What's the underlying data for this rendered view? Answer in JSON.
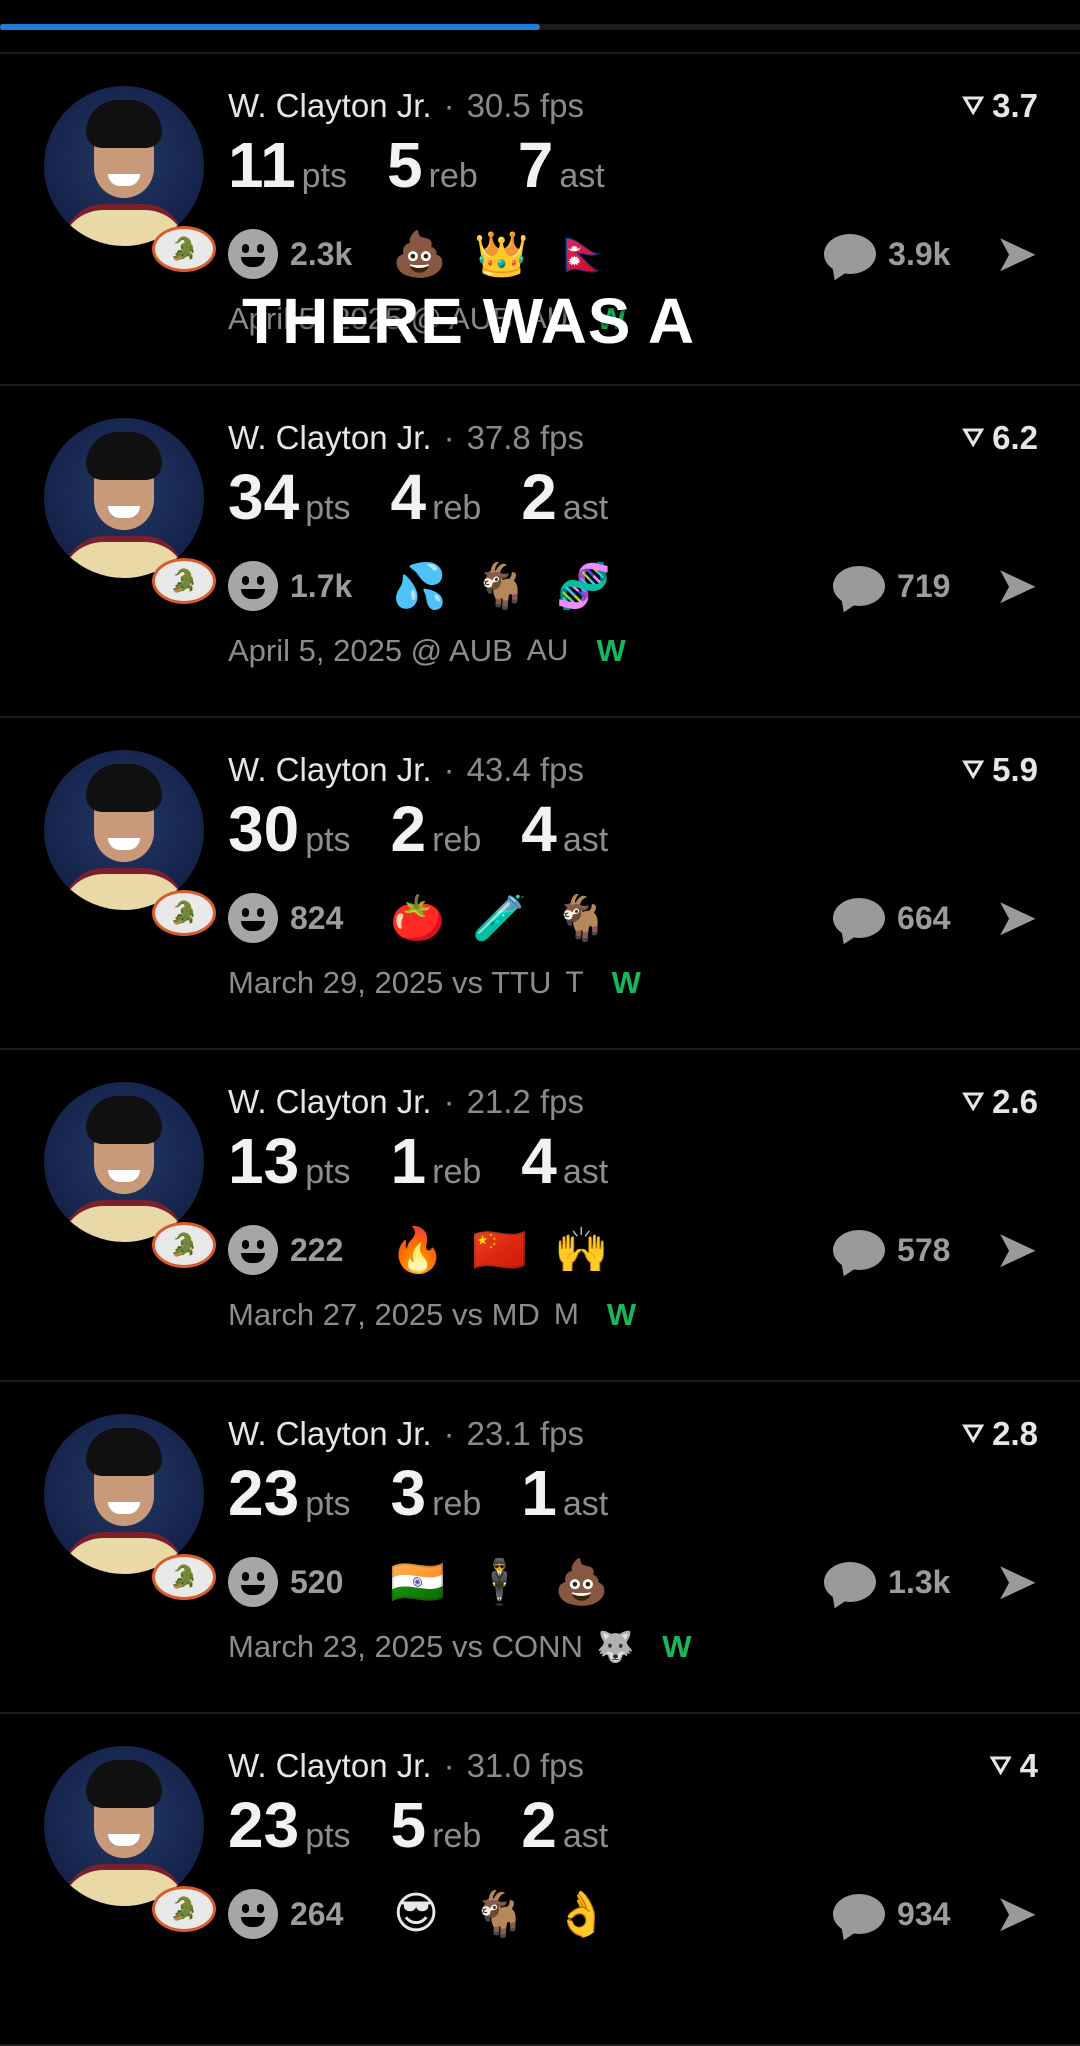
{
  "progress": {
    "fraction": 0.5
  },
  "caption": "THERE WAS A",
  "cards": [
    {
      "name": "W. Clayton Jr.",
      "fps": "30.5 fps",
      "rating": "3.7",
      "stats": [
        {
          "num": "11",
          "unit": "pts"
        },
        {
          "num": "5",
          "unit": "reb"
        },
        {
          "num": "7",
          "unit": "ast"
        }
      ],
      "reactions_count": "2.3k",
      "emojis": [
        "💩",
        "👑",
        "🇳🇵"
      ],
      "comments": "3.9k",
      "date": "April 5, 2025 @ AUB",
      "opp_logo": "AU",
      "result": "W"
    },
    {
      "name": "W. Clayton Jr.",
      "fps": "37.8 fps",
      "rating": "6.2",
      "stats": [
        {
          "num": "34",
          "unit": "pts"
        },
        {
          "num": "4",
          "unit": "reb"
        },
        {
          "num": "2",
          "unit": "ast"
        }
      ],
      "reactions_count": "1.7k",
      "emojis": [
        "💦",
        "🐐",
        "🧬"
      ],
      "comments": "719",
      "date": "April 5, 2025 @ AUB",
      "opp_logo": "AU",
      "result": "W"
    },
    {
      "name": "W. Clayton Jr.",
      "fps": "43.4 fps",
      "rating": "5.9",
      "stats": [
        {
          "num": "30",
          "unit": "pts"
        },
        {
          "num": "2",
          "unit": "reb"
        },
        {
          "num": "4",
          "unit": "ast"
        }
      ],
      "reactions_count": "824",
      "emojis": [
        "🍅",
        "🧪",
        "🐐"
      ],
      "comments": "664",
      "date": "March 29, 2025 vs TTU",
      "opp_logo": "T",
      "result": "W"
    },
    {
      "name": "W. Clayton Jr.",
      "fps": "21.2 fps",
      "rating": "2.6",
      "stats": [
        {
          "num": "13",
          "unit": "pts"
        },
        {
          "num": "1",
          "unit": "reb"
        },
        {
          "num": "4",
          "unit": "ast"
        }
      ],
      "reactions_count": "222",
      "emojis": [
        "🔥",
        "🇨🇳",
        "🙌"
      ],
      "comments": "578",
      "date": "March 27, 2025 vs MD",
      "opp_logo": "M",
      "result": "W"
    },
    {
      "name": "W. Clayton Jr.",
      "fps": "23.1 fps",
      "rating": "2.8",
      "stats": [
        {
          "num": "23",
          "unit": "pts"
        },
        {
          "num": "3",
          "unit": "reb"
        },
        {
          "num": "1",
          "unit": "ast"
        }
      ],
      "reactions_count": "520",
      "emojis": [
        "🇮🇳",
        "🕴",
        "💩"
      ],
      "comments": "1.3k",
      "date": "March 23, 2025 vs CONN",
      "opp_logo": "🐺",
      "result": "W"
    },
    {
      "name": "W. Clayton Jr.",
      "fps": "31.0 fps",
      "rating": "4",
      "stats": [
        {
          "num": "23",
          "unit": "pts"
        },
        {
          "num": "5",
          "unit": "reb"
        },
        {
          "num": "2",
          "unit": "ast"
        }
      ],
      "reactions_count": "264",
      "emojis": [
        "😎",
        "🐐",
        "👌"
      ],
      "comments": "934",
      "date": "",
      "opp_logo": "",
      "result": ""
    }
  ]
}
